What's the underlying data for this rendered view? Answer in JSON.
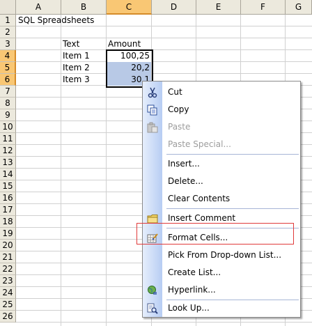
{
  "columns": [
    "A",
    "B",
    "C",
    "D",
    "E",
    "F",
    "G"
  ],
  "rows": [
    "1",
    "2",
    "3",
    "4",
    "5",
    "6",
    "7",
    "8",
    "9",
    "10",
    "11",
    "12",
    "13",
    "14",
    "15",
    "16",
    "17",
    "18",
    "19",
    "20",
    "21",
    "22",
    "23",
    "24",
    "25",
    "26"
  ],
  "cells": {
    "a1": "SQL Spreadsheets",
    "b3": "Text",
    "c3": "Amount",
    "b4": "Item 1",
    "c4": "100,25",
    "b5": "Item 2",
    "c5": "20,2",
    "b6": "Item 3",
    "c6": "30,1"
  },
  "menu": {
    "cut": "Cut",
    "copy": "Copy",
    "paste": "Paste",
    "paste_special": "Paste Special...",
    "insert": "Insert...",
    "delete": "Delete...",
    "clear_contents": "Clear Contents",
    "insert_comment": "Insert Comment",
    "format_cells": "Format Cells...",
    "pick_from_list": "Pick From Drop-down List...",
    "create_list": "Create List...",
    "hyperlink": "Hyperlink...",
    "look_up": "Look Up..."
  },
  "colors": {
    "selected_header": "#f9c774",
    "selection_fill": "#b8c9e6",
    "highlight_box": "#e03a3a"
  }
}
